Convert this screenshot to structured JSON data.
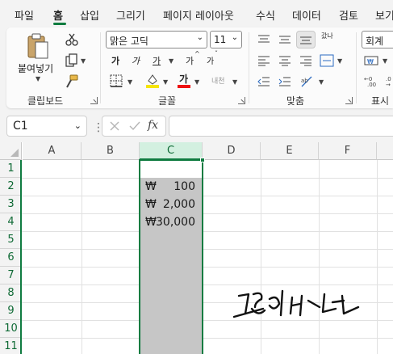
{
  "menu": {
    "tabs": [
      "파일",
      "홈",
      "삽입",
      "그리기",
      "페이지 레이아웃",
      "수식",
      "데이터",
      "검토",
      "보기"
    ],
    "active": "홈"
  },
  "ribbon": {
    "clipboard": {
      "paste_label": "붙여넣기",
      "group_label": "클립보드"
    },
    "font": {
      "font_name": "맑은 고딕",
      "font_size": "11",
      "bold": "가",
      "italic": "가",
      "underline": "가",
      "grow": "가",
      "shrink": "가",
      "font_color_letter": "가",
      "phonetic": "내천",
      "group_label": "글꼴"
    },
    "alignment": {
      "wrap": "갔나",
      "group_label": "맞춤"
    },
    "number": {
      "format": "회계",
      "group_label": "표시"
    }
  },
  "formula_bar": {
    "name_box": "C1",
    "fx": "fx",
    "formula": ""
  },
  "sheet": {
    "columns": [
      "A",
      "B",
      "C",
      "D",
      "E",
      "F"
    ],
    "selected_column": "C",
    "rows": [
      "1",
      "2",
      "3",
      "4",
      "5",
      "6",
      "7",
      "8",
      "9",
      "10",
      "11"
    ],
    "cells": [
      {
        "row": 2,
        "symbol": "₩",
        "value": "100"
      },
      {
        "row": 3,
        "symbol": "₩",
        "value": "2,000"
      },
      {
        "row": 4,
        "symbol": "₩",
        "value": "30,000"
      }
    ],
    "selection_color": "#107c41"
  },
  "watermark": "김통의 바나나"
}
